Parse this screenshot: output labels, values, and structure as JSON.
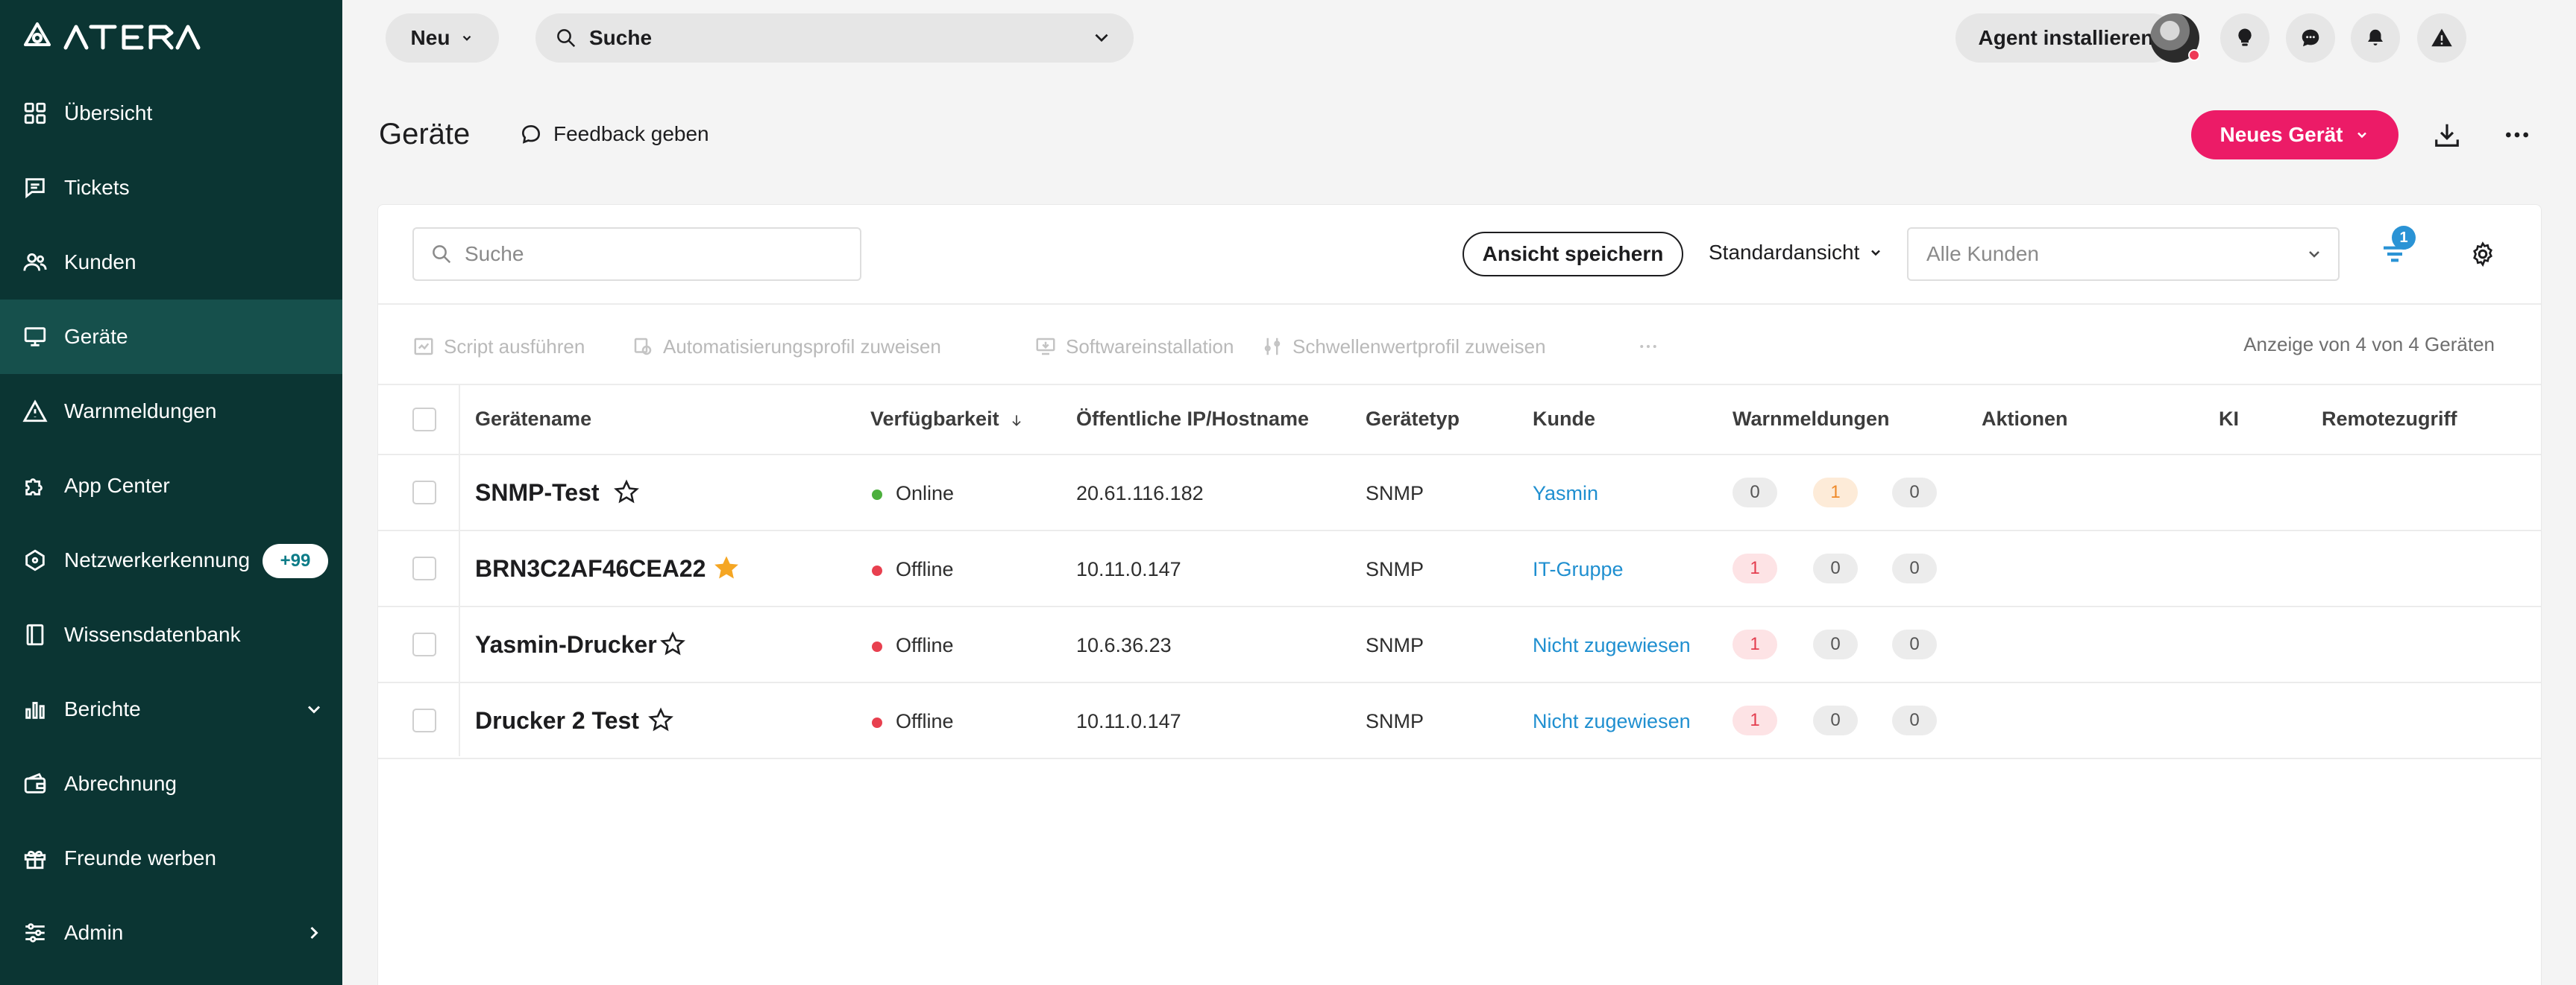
{
  "app": {
    "logo_text": "ATERA"
  },
  "sidebar": {
    "items": [
      {
        "label": "Übersicht",
        "icon": "grid-icon"
      },
      {
        "label": "Tickets",
        "icon": "ticket-icon"
      },
      {
        "label": "Kunden",
        "icon": "users-icon"
      },
      {
        "label": "Geräte",
        "icon": "monitor-icon",
        "active": true
      },
      {
        "label": "Warnmeldungen",
        "icon": "warning-icon"
      },
      {
        "label": "App Center",
        "icon": "puzzle-icon"
      },
      {
        "label": "Netzwerkerkennung",
        "icon": "network-icon",
        "badge": "+99"
      },
      {
        "label": "Wissensdatenbank",
        "icon": "book-icon"
      },
      {
        "label": "Berichte",
        "icon": "chart-icon",
        "chevron": "down"
      },
      {
        "label": "Abrechnung",
        "icon": "wallet-icon"
      },
      {
        "label": "Freunde werben",
        "icon": "gift-icon"
      },
      {
        "label": "Admin",
        "icon": "sliders-icon",
        "chevron": "right"
      }
    ]
  },
  "topbar": {
    "new_label": "Neu",
    "search_label": "Suche",
    "agent_label": "Agent installieren"
  },
  "header": {
    "title": "Geräte",
    "feedback_label": "Feedback geben",
    "new_device_label": "Neues Gerät"
  },
  "toolbar": {
    "search_placeholder": "Suche",
    "save_view_label": "Ansicht speichern",
    "view_label": "Standardansicht",
    "customer_placeholder": "Alle Kunden",
    "filter_count": "1"
  },
  "bulk_actions": {
    "run_script": "Script ausführen",
    "assign_automation": "Automatisierungsprofil zuweisen",
    "software_install": "Softwareinstallation",
    "assign_threshold": "Schwellenwertprofil zuweisen",
    "count_text": "Anzeige von 4 von 4 Geräten"
  },
  "table": {
    "columns": {
      "name": "Gerätename",
      "availability": "Verfügbarkeit",
      "ip": "Öffentliche IP/Hostname",
      "type": "Gerätetyp",
      "customer": "Kunde",
      "alerts": "Warnmeldungen",
      "actions": "Aktionen",
      "ai": "KI",
      "remote": "Remotezugriff"
    },
    "rows": [
      {
        "name": "SNMP-Test",
        "starred": false,
        "status": "Online",
        "status_color": "#4caf3d",
        "ip": "20.61.116.182",
        "type": "SNMP",
        "customer": "Yasmin",
        "alerts": [
          "0",
          "1",
          "0"
        ],
        "alert_styles": [
          "gray",
          "orange",
          "gray"
        ]
      },
      {
        "name": "BRN3C2AF46CEA22",
        "starred": true,
        "status": "Offline",
        "status_color": "#e8404f",
        "ip": "10.11.0.147",
        "type": "SNMP",
        "customer": "IT-Gruppe",
        "alerts": [
          "1",
          "0",
          "0"
        ],
        "alert_styles": [
          "red",
          "gray",
          "gray"
        ]
      },
      {
        "name": "Yasmin-Drucker",
        "starred": false,
        "status": "Offline",
        "status_color": "#e8404f",
        "ip": "10.6.36.23",
        "type": "SNMP",
        "customer": "Nicht zugewiesen",
        "alerts": [
          "1",
          "0",
          "0"
        ],
        "alert_styles": [
          "red",
          "gray",
          "gray"
        ]
      },
      {
        "name": "Drucker 2 Test",
        "starred": false,
        "status": "Offline",
        "status_color": "#e8404f",
        "ip": "10.11.0.147",
        "type": "SNMP",
        "customer": "Nicht zugewiesen",
        "alerts": [
          "1",
          "0",
          "0"
        ],
        "alert_styles": [
          "red",
          "gray",
          "gray"
        ]
      }
    ]
  },
  "colors": {
    "sidebar_bg": "#0b3533",
    "active_bg": "#16504c",
    "accent_pink": "#ec1b67",
    "link_blue": "#1f8fd0"
  }
}
